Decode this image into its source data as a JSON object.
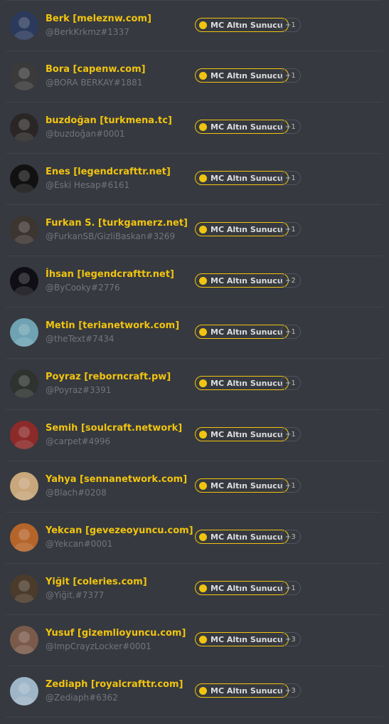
{
  "members": [
    {
      "name": "Berk [meleznw.com]",
      "tag": "@BerkKrkmz#1337",
      "role": "MC Altın Sunucu",
      "more": "+1",
      "avatar_icon": "avatar-image-icon",
      "avatar_color": "#2b3a5c"
    },
    {
      "name": "Bora [capenw.com]",
      "tag": "@BORA BERKAY#1881",
      "role": "MC Altın Sunucu",
      "more": "+1",
      "avatar_icon": "avatar-image-icon",
      "avatar_color": "#3a3a3a"
    },
    {
      "name": "buzdoğan [turkmena.tc]",
      "tag": "@buzdoğan#0001",
      "role": "MC Altın Sunucu",
      "more": "+1",
      "avatar_icon": "avatar-image-icon",
      "avatar_color": "#2a2626"
    },
    {
      "name": "Enes [legendcrafttr.net]",
      "tag": "@Eski Hesap#6161",
      "role": "MC Altın Sunucu",
      "more": "+1",
      "avatar_icon": "wolf-avatar-icon",
      "avatar_color": "#111111"
    },
    {
      "name": "Furkan S. [turkgamerz.net]",
      "tag": "@FurkanSB/GizliBaskan#3269",
      "role": "MC Altın Sunucu",
      "more": "+1",
      "avatar_icon": "avatar-image-icon",
      "avatar_color": "#3d3530"
    },
    {
      "name": "İhsan [legendcrafttr.net]",
      "tag": "@ByCooky#2776",
      "role": "MC Altın Sunucu",
      "more": "+2",
      "avatar_icon": "dragon-avatar-icon",
      "avatar_color": "#0e0e14"
    },
    {
      "name": "Metin [terianetwork.com]",
      "tag": "@theText#7434",
      "role": "MC Altın Sunucu",
      "more": "+1",
      "avatar_icon": "avatar-image-icon",
      "avatar_color": "#6fa3b3"
    },
    {
      "name": "Poyraz [reborncraft.pw]",
      "tag": "@Poyraz#3391",
      "role": "MC Altın Sunucu",
      "more": "+1",
      "avatar_icon": "avatar-image-icon",
      "avatar_color": "#2f332f"
    },
    {
      "name": "Semih [soulcraft.network]",
      "tag": "@carpet#4996",
      "role": "MC Altın Sunucu",
      "more": "+1",
      "avatar_icon": "carpet-avatar-icon",
      "avatar_color": "#8c2a2a"
    },
    {
      "name": "Yahya [sennanetwork.com]",
      "tag": "@Blach#0208",
      "role": "MC Altın Sunucu",
      "more": "+1",
      "avatar_icon": "cat-avatar-icon",
      "avatar_color": "#c8a77c"
    },
    {
      "name": "Yekcan [gevezeoyuncu.com]",
      "tag": "@Yekcan#0001",
      "role": "MC Altın Sunucu",
      "more": "+3",
      "avatar_icon": "avatar-image-icon",
      "avatar_color": "#b5652a"
    },
    {
      "name": "Yiğit [coleries.com]",
      "tag": "@Yiğit.#7377",
      "role": "MC Altın Sunucu",
      "more": "+1",
      "avatar_icon": "avatar-image-icon",
      "avatar_color": "#4a3b2a"
    },
    {
      "name": "Yusuf [gizemlioyuncu.com]",
      "tag": "@ImpCrayzLocker#0001",
      "role": "MC Altın Sunucu",
      "more": "+3",
      "avatar_icon": "avatar-image-icon",
      "avatar_color": "#7a5a4a"
    },
    {
      "name": "Zediaph [royalcrafttr.com]",
      "tag": "@Zediaph#6362",
      "role": "MC Altın Sunucu",
      "more": "+3",
      "avatar_icon": "avatar-image-icon",
      "avatar_color": "#9fb6c8"
    }
  ],
  "colors": {
    "background": "#36393f",
    "name": "#f1c40f",
    "role_accent": "#f1c40f",
    "tag": "#72767d",
    "divider": "#40444b"
  }
}
